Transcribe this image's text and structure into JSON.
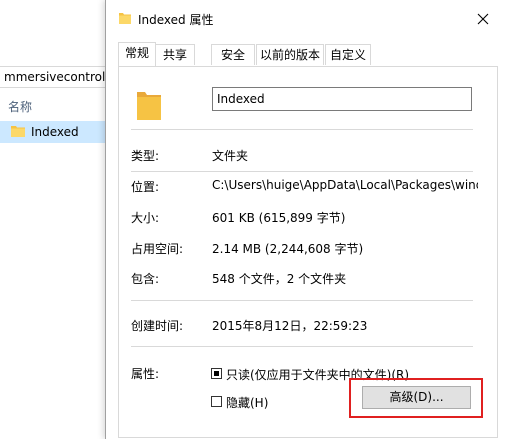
{
  "explorer": {
    "address_text": "mmersivecontrolpa",
    "column_header": "名称",
    "row_label": "Indexed"
  },
  "dialog": {
    "title": "Indexed 属性",
    "tabs": [
      "常规",
      "共享",
      "安全",
      "以前的版本",
      "自定义"
    ],
    "active_tab": "常规",
    "name_value": "Indexed",
    "type_label": "类型:",
    "type_value": "文件夹",
    "location_label": "位置:",
    "location_value": "C:\\Users\\huige\\AppData\\Local\\Packages\\window",
    "size_label": "大小:",
    "size_value": "601 KB (615,899 字节)",
    "disk_size_label": "占用空间:",
    "disk_size_value": "2.14 MB (2,244,608 字节)",
    "contains_label": "包含:",
    "contains_value": "548 个文件，2 个文件夹",
    "created_label": "创建时间:",
    "created_value": "2015年8月12日，22:59:23",
    "attributes_label": "属性:",
    "readonly_label": "只读(仅应用于文件夹中的文件)(R)",
    "readonly_state": "partial",
    "hidden_label": "隐藏(H)",
    "hidden_checked": false,
    "advanced_button": "高级(D)..."
  },
  "colors": {
    "folder": "#f6c344",
    "selection": "#cce8ff",
    "highlight": "#e02020"
  }
}
